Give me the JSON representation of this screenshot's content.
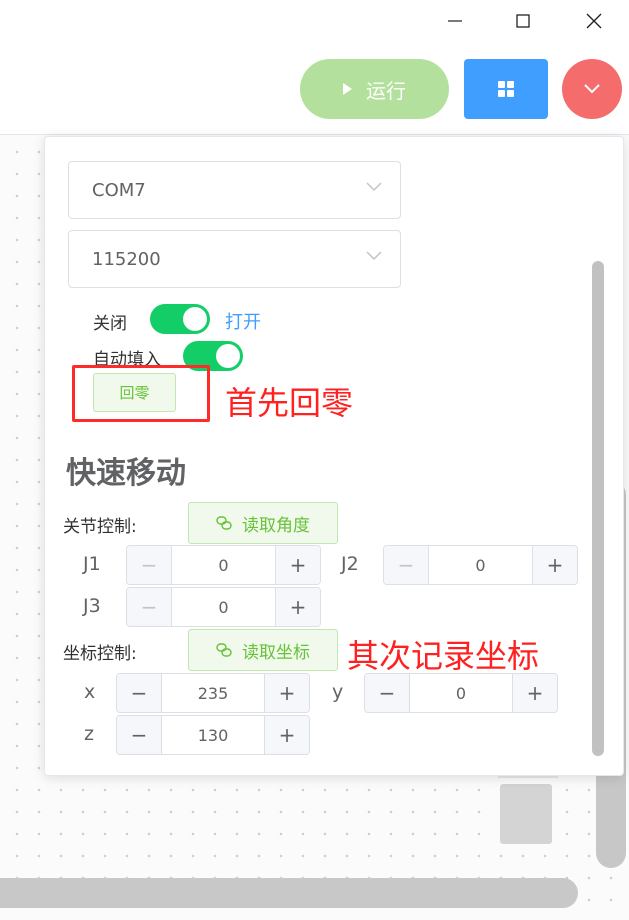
{
  "window": {
    "minimize_icon": "minimize-icon",
    "maximize_icon": "maximize-icon",
    "close_icon": "close-icon"
  },
  "toolbar": {
    "run_label": "运行",
    "run_color": "#b3e19d",
    "grid_color": "#409eff",
    "dropdown_color": "#f56c6c"
  },
  "connection": {
    "port": "COM7",
    "baud": "115200",
    "power_off_label": "关闭",
    "power_on_label": "打开",
    "power_on": true,
    "autofill_label": "自动填入",
    "autofill_on": true,
    "home_button": "回零"
  },
  "annotations": {
    "first": "首先回零",
    "second": "其次记录坐标"
  },
  "quick_move": {
    "title": "快速移动",
    "joint_label": "关节控制:",
    "read_angle_button": "读取角度",
    "joints": [
      {
        "name": "J1",
        "value": "0"
      },
      {
        "name": "J2",
        "value": "0"
      },
      {
        "name": "J3",
        "value": "0"
      }
    ],
    "coord_label": "坐标控制:",
    "read_coord_button": "读取坐标",
    "coords": [
      {
        "name": "x",
        "value": "235"
      },
      {
        "name": "y",
        "value": "0"
      },
      {
        "name": "z",
        "value": "130"
      }
    ],
    "minus": "−",
    "plus": "+"
  }
}
